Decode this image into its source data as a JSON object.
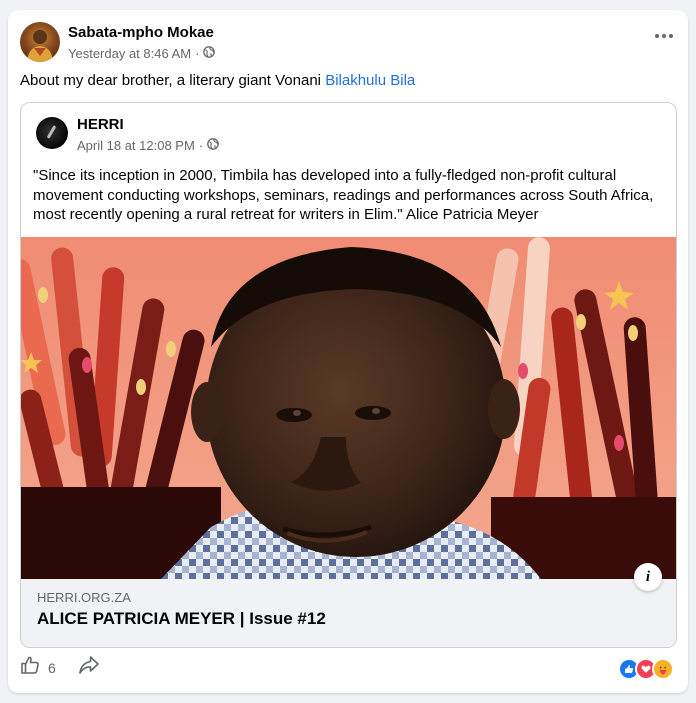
{
  "post": {
    "author": "Sabata-mpho Mokae",
    "timestamp": "Yesterday at 8:46 AM",
    "separator": "·",
    "text": "About my dear brother, a literary giant Vonani ",
    "tag": "Bilakhulu Bila"
  },
  "shared_post": {
    "author": "HERRI",
    "timestamp": "April 18 at 12:08 PM",
    "separator": "·",
    "text": "\"Since its inception in 2000, Timbila has developed into a fully-fledged non-profit cultural movement conducting workshops, seminars, readings and performances across South Africa, most recently opening a rural retreat for writers in Elim.\" Alice Patricia Meyer"
  },
  "link": {
    "domain": "HERRI.ORG.ZA",
    "title": "ALICE PATRICIA MEYER | Issue #12",
    "info_label": "i"
  },
  "footer": {
    "like_count": "6"
  },
  "icons": {
    "globe": "globe-icon",
    "more": "more-icon",
    "like": "thumbs-up-icon",
    "share": "share-icon",
    "reactions": [
      "like-reaction",
      "love-reaction",
      "care-reaction"
    ]
  },
  "colors": {
    "link_blue": "#216fdb",
    "secondary_text": "#65676b",
    "like_blue": "#1877f2",
    "love_red": "#f33e58",
    "care_yellow": "#f7b125"
  }
}
